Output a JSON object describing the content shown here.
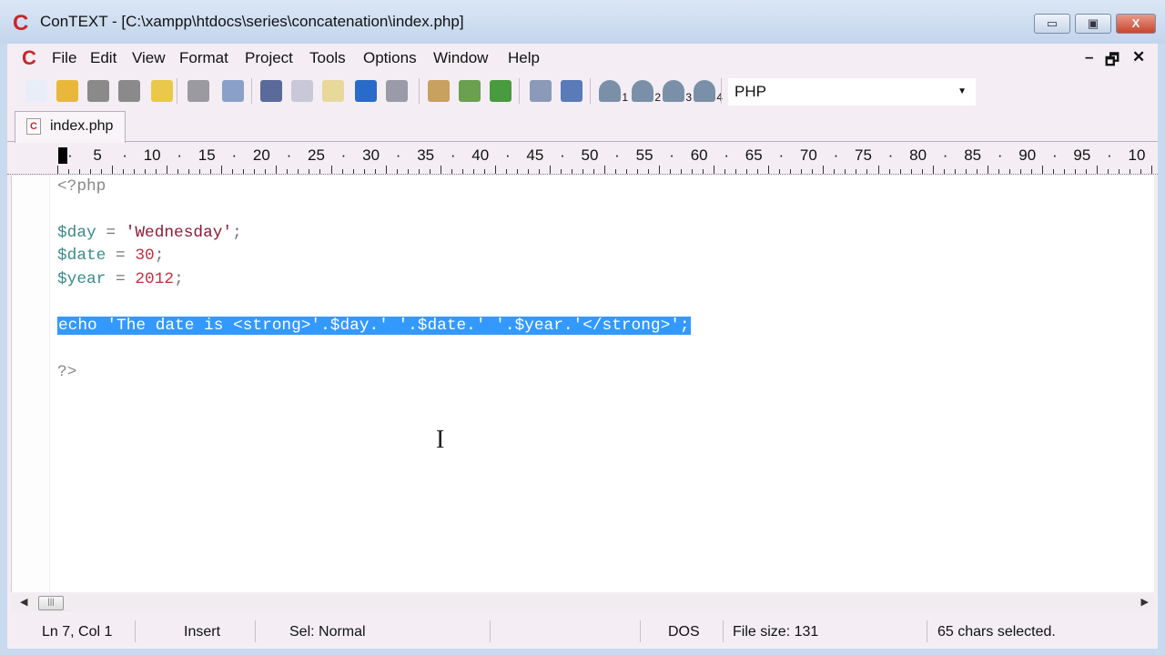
{
  "window": {
    "title": "ConTEXT - [C:\\xampp\\htdocs\\series\\concatenation\\index.php]",
    "logo": "C",
    "minimize": "▭",
    "maximize": "▣",
    "close": "X"
  },
  "menu": {
    "items": [
      "File",
      "Edit",
      "View",
      "Format",
      "Project",
      "Tools",
      "Options",
      "Window",
      "Help"
    ],
    "mdi_minimize": "–",
    "mdi_restore": "🗗",
    "mdi_close": "✕"
  },
  "toolbar": {
    "icons": [
      "new-file",
      "open-file",
      "save",
      "save-all",
      "open-folder",
      "print",
      "print-preview",
      "cut",
      "copy",
      "paste",
      "undo",
      "redo",
      "find",
      "find-next",
      "replace",
      "file-properties",
      "tools",
      "user-command-1",
      "user-command-2",
      "user-command-3",
      "user-command-4"
    ],
    "user_labels": [
      "1",
      "2",
      "3",
      "4"
    ],
    "language": "PHP"
  },
  "tab": {
    "label": "index.php"
  },
  "ruler": {
    "labels": [
      "5",
      "10",
      "15",
      "20",
      "25",
      "30",
      "35",
      "40",
      "45",
      "50",
      "55",
      "60",
      "65",
      "70",
      "75",
      "80",
      "85",
      "90",
      "95",
      "10"
    ]
  },
  "code": {
    "l1": "<?php",
    "l3": {
      "var": "$day",
      "op": " = ",
      "str": "'Wednesday'",
      "end": ";"
    },
    "l4": {
      "var": "$date",
      "op": " = ",
      "num": "30",
      "end": ";"
    },
    "l5": {
      "var": "$year",
      "op": " = ",
      "num": "2012",
      "end": ";"
    },
    "l7": "echo 'The date is <strong>'.$day.' '.$date.' '.$year.'</strong>';",
    "l9": "?>"
  },
  "status": {
    "position": "Ln 7, Col 1",
    "mode": "Insert",
    "selection_mode": "Sel: Normal",
    "line_endings": "DOS",
    "file_size": "File size: 131",
    "selected": "65 chars selected."
  },
  "colors": {
    "selection": "#3399ff",
    "variable": "#3a8a8a",
    "string": "#8c1a3a",
    "number": "#c03040"
  }
}
